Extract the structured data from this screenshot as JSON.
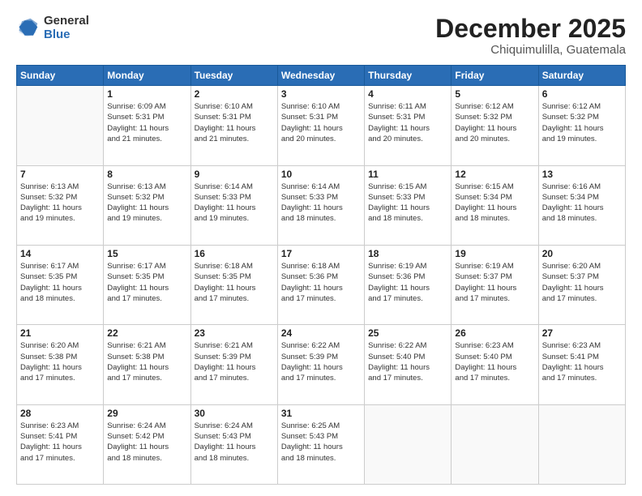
{
  "logo": {
    "general": "General",
    "blue": "Blue"
  },
  "header": {
    "month": "December 2025",
    "location": "Chiquimulilla, Guatemala"
  },
  "weekdays": [
    "Sunday",
    "Monday",
    "Tuesday",
    "Wednesday",
    "Thursday",
    "Friday",
    "Saturday"
  ],
  "weeks": [
    [
      {
        "day": "",
        "info": ""
      },
      {
        "day": "1",
        "info": "Sunrise: 6:09 AM\nSunset: 5:31 PM\nDaylight: 11 hours\nand 21 minutes."
      },
      {
        "day": "2",
        "info": "Sunrise: 6:10 AM\nSunset: 5:31 PM\nDaylight: 11 hours\nand 21 minutes."
      },
      {
        "day": "3",
        "info": "Sunrise: 6:10 AM\nSunset: 5:31 PM\nDaylight: 11 hours\nand 20 minutes."
      },
      {
        "day": "4",
        "info": "Sunrise: 6:11 AM\nSunset: 5:31 PM\nDaylight: 11 hours\nand 20 minutes."
      },
      {
        "day": "5",
        "info": "Sunrise: 6:12 AM\nSunset: 5:32 PM\nDaylight: 11 hours\nand 20 minutes."
      },
      {
        "day": "6",
        "info": "Sunrise: 6:12 AM\nSunset: 5:32 PM\nDaylight: 11 hours\nand 19 minutes."
      }
    ],
    [
      {
        "day": "7",
        "info": "Sunrise: 6:13 AM\nSunset: 5:32 PM\nDaylight: 11 hours\nand 19 minutes."
      },
      {
        "day": "8",
        "info": "Sunrise: 6:13 AM\nSunset: 5:32 PM\nDaylight: 11 hours\nand 19 minutes."
      },
      {
        "day": "9",
        "info": "Sunrise: 6:14 AM\nSunset: 5:33 PM\nDaylight: 11 hours\nand 19 minutes."
      },
      {
        "day": "10",
        "info": "Sunrise: 6:14 AM\nSunset: 5:33 PM\nDaylight: 11 hours\nand 18 minutes."
      },
      {
        "day": "11",
        "info": "Sunrise: 6:15 AM\nSunset: 5:33 PM\nDaylight: 11 hours\nand 18 minutes."
      },
      {
        "day": "12",
        "info": "Sunrise: 6:15 AM\nSunset: 5:34 PM\nDaylight: 11 hours\nand 18 minutes."
      },
      {
        "day": "13",
        "info": "Sunrise: 6:16 AM\nSunset: 5:34 PM\nDaylight: 11 hours\nand 18 minutes."
      }
    ],
    [
      {
        "day": "14",
        "info": "Sunrise: 6:17 AM\nSunset: 5:35 PM\nDaylight: 11 hours\nand 18 minutes."
      },
      {
        "day": "15",
        "info": "Sunrise: 6:17 AM\nSunset: 5:35 PM\nDaylight: 11 hours\nand 17 minutes."
      },
      {
        "day": "16",
        "info": "Sunrise: 6:18 AM\nSunset: 5:35 PM\nDaylight: 11 hours\nand 17 minutes."
      },
      {
        "day": "17",
        "info": "Sunrise: 6:18 AM\nSunset: 5:36 PM\nDaylight: 11 hours\nand 17 minutes."
      },
      {
        "day": "18",
        "info": "Sunrise: 6:19 AM\nSunset: 5:36 PM\nDaylight: 11 hours\nand 17 minutes."
      },
      {
        "day": "19",
        "info": "Sunrise: 6:19 AM\nSunset: 5:37 PM\nDaylight: 11 hours\nand 17 minutes."
      },
      {
        "day": "20",
        "info": "Sunrise: 6:20 AM\nSunset: 5:37 PM\nDaylight: 11 hours\nand 17 minutes."
      }
    ],
    [
      {
        "day": "21",
        "info": "Sunrise: 6:20 AM\nSunset: 5:38 PM\nDaylight: 11 hours\nand 17 minutes."
      },
      {
        "day": "22",
        "info": "Sunrise: 6:21 AM\nSunset: 5:38 PM\nDaylight: 11 hours\nand 17 minutes."
      },
      {
        "day": "23",
        "info": "Sunrise: 6:21 AM\nSunset: 5:39 PM\nDaylight: 11 hours\nand 17 minutes."
      },
      {
        "day": "24",
        "info": "Sunrise: 6:22 AM\nSunset: 5:39 PM\nDaylight: 11 hours\nand 17 minutes."
      },
      {
        "day": "25",
        "info": "Sunrise: 6:22 AM\nSunset: 5:40 PM\nDaylight: 11 hours\nand 17 minutes."
      },
      {
        "day": "26",
        "info": "Sunrise: 6:23 AM\nSunset: 5:40 PM\nDaylight: 11 hours\nand 17 minutes."
      },
      {
        "day": "27",
        "info": "Sunrise: 6:23 AM\nSunset: 5:41 PM\nDaylight: 11 hours\nand 17 minutes."
      }
    ],
    [
      {
        "day": "28",
        "info": "Sunrise: 6:23 AM\nSunset: 5:41 PM\nDaylight: 11 hours\nand 17 minutes."
      },
      {
        "day": "29",
        "info": "Sunrise: 6:24 AM\nSunset: 5:42 PM\nDaylight: 11 hours\nand 18 minutes."
      },
      {
        "day": "30",
        "info": "Sunrise: 6:24 AM\nSunset: 5:43 PM\nDaylight: 11 hours\nand 18 minutes."
      },
      {
        "day": "31",
        "info": "Sunrise: 6:25 AM\nSunset: 5:43 PM\nDaylight: 11 hours\nand 18 minutes."
      },
      {
        "day": "",
        "info": ""
      },
      {
        "day": "",
        "info": ""
      },
      {
        "day": "",
        "info": ""
      }
    ]
  ]
}
